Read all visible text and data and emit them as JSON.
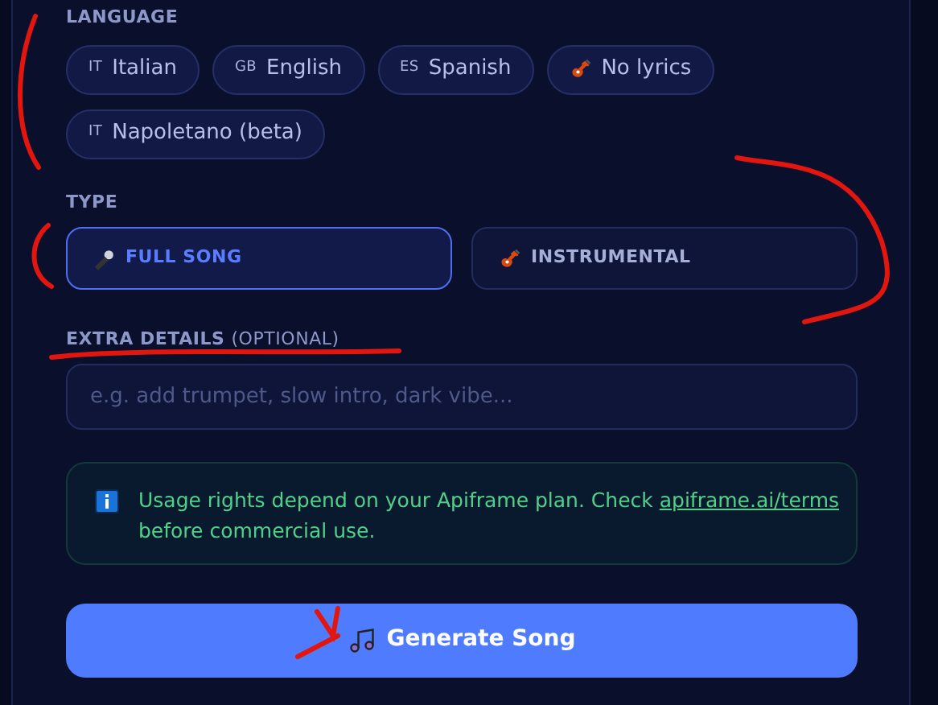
{
  "language": {
    "label": "LANGUAGE",
    "options": [
      {
        "kind": "code",
        "code": "IT",
        "label": "Italian",
        "selected": false
      },
      {
        "kind": "code",
        "code": "GB",
        "label": "English",
        "selected": false
      },
      {
        "kind": "code",
        "code": "ES",
        "label": "Spanish",
        "selected": false
      },
      {
        "kind": "guitar",
        "label": "No lyrics",
        "selected": false
      },
      {
        "kind": "code",
        "code": "IT",
        "label": "Napoletano (beta)",
        "selected": false
      }
    ]
  },
  "type": {
    "label": "TYPE",
    "options": [
      {
        "kind": "microphone",
        "label": "FULL SONG",
        "selected": true
      },
      {
        "kind": "guitar",
        "label": "INSTRUMENTAL",
        "selected": false
      }
    ]
  },
  "extra_details": {
    "label": "EXTRA DETAILS",
    "hint": "(OPTIONAL)",
    "placeholder": "e.g. add trumpet, slow intro, dark vibe..."
  },
  "notice": {
    "text": "Usage rights depend on your Apiframe plan. Check",
    "link": "apiframe.ai/terms",
    "text_after": "before commercial use."
  },
  "generate_button": {
    "label": "Generate Song"
  }
}
